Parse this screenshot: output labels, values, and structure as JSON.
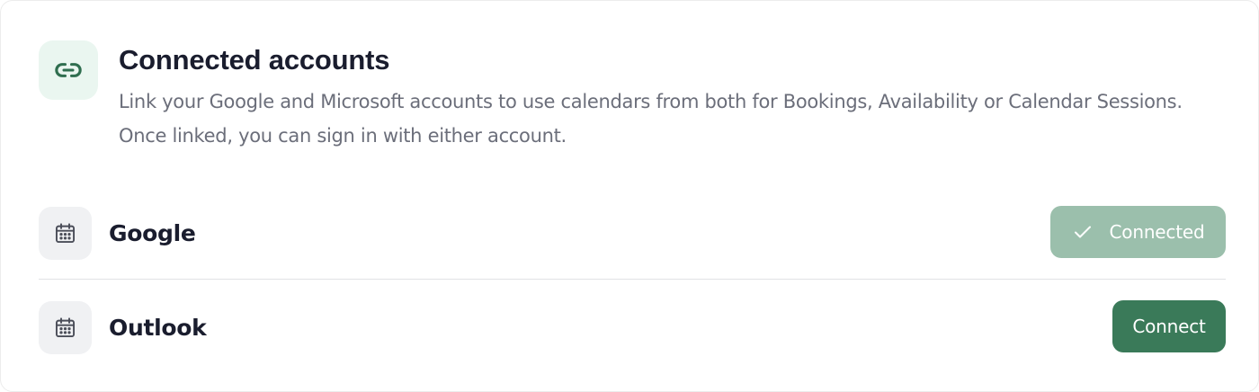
{
  "section": {
    "title": "Connected accounts",
    "description": "Link your Google and Microsoft accounts to use calendars from both for Bookings, Availability or Calendar Sessions. Once linked, you can sign in with either account.",
    "icon": "link-icon"
  },
  "accounts": [
    {
      "name": "Google",
      "icon": "calendar-icon",
      "status": "connected",
      "button_label": "Connected",
      "button_icon": "check-icon"
    },
    {
      "name": "Outlook",
      "icon": "calendar-icon",
      "status": "not-connected",
      "button_label": "Connect"
    }
  ],
  "colors": {
    "accent": "#3a7a59",
    "connected_button": "#9bbfac",
    "header_icon_bg": "#eaf6f0",
    "title": "#1a1d2e",
    "muted_text": "#6b6e7a"
  }
}
